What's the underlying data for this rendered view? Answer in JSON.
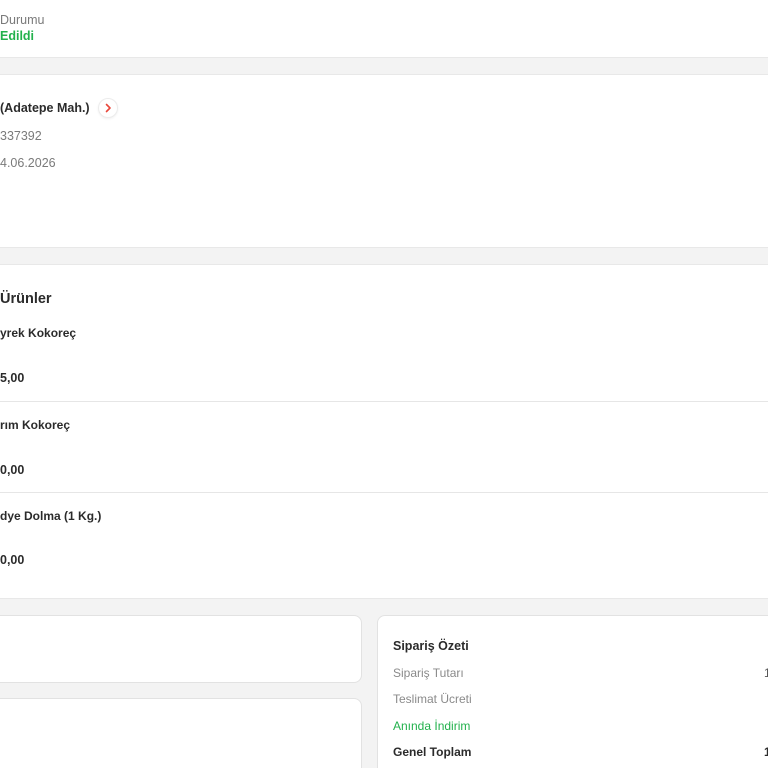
{
  "status": {
    "label": "Durumu",
    "value": "Edildi"
  },
  "restaurant": {
    "name": "(Adatepe Mah.)",
    "order_no": "337392",
    "date": "4.06.2026"
  },
  "products": {
    "title": "Ürünler",
    "items": [
      {
        "name": "yrek Kokoreç",
        "price": "5,00"
      },
      {
        "name": "rım Kokoreç",
        "price": "0,00"
      },
      {
        "name": "dye Dolma (1 Kg.)",
        "price": "0,00"
      }
    ]
  },
  "summary": {
    "title": "Sipariş Özeti",
    "rows": [
      {
        "label": "Sipariş Tutarı",
        "value": "1"
      },
      {
        "label": "Teslimat Ücreti",
        "value": ""
      },
      {
        "label": "Anında İndirim",
        "value": ""
      },
      {
        "label": "Genel Toplam",
        "value": "1"
      }
    ]
  },
  "colors": {
    "accent_green": "#22b14c",
    "chevron_red": "#e8473b"
  },
  "icons": {
    "restaurant_link": "chevron-right-icon"
  }
}
